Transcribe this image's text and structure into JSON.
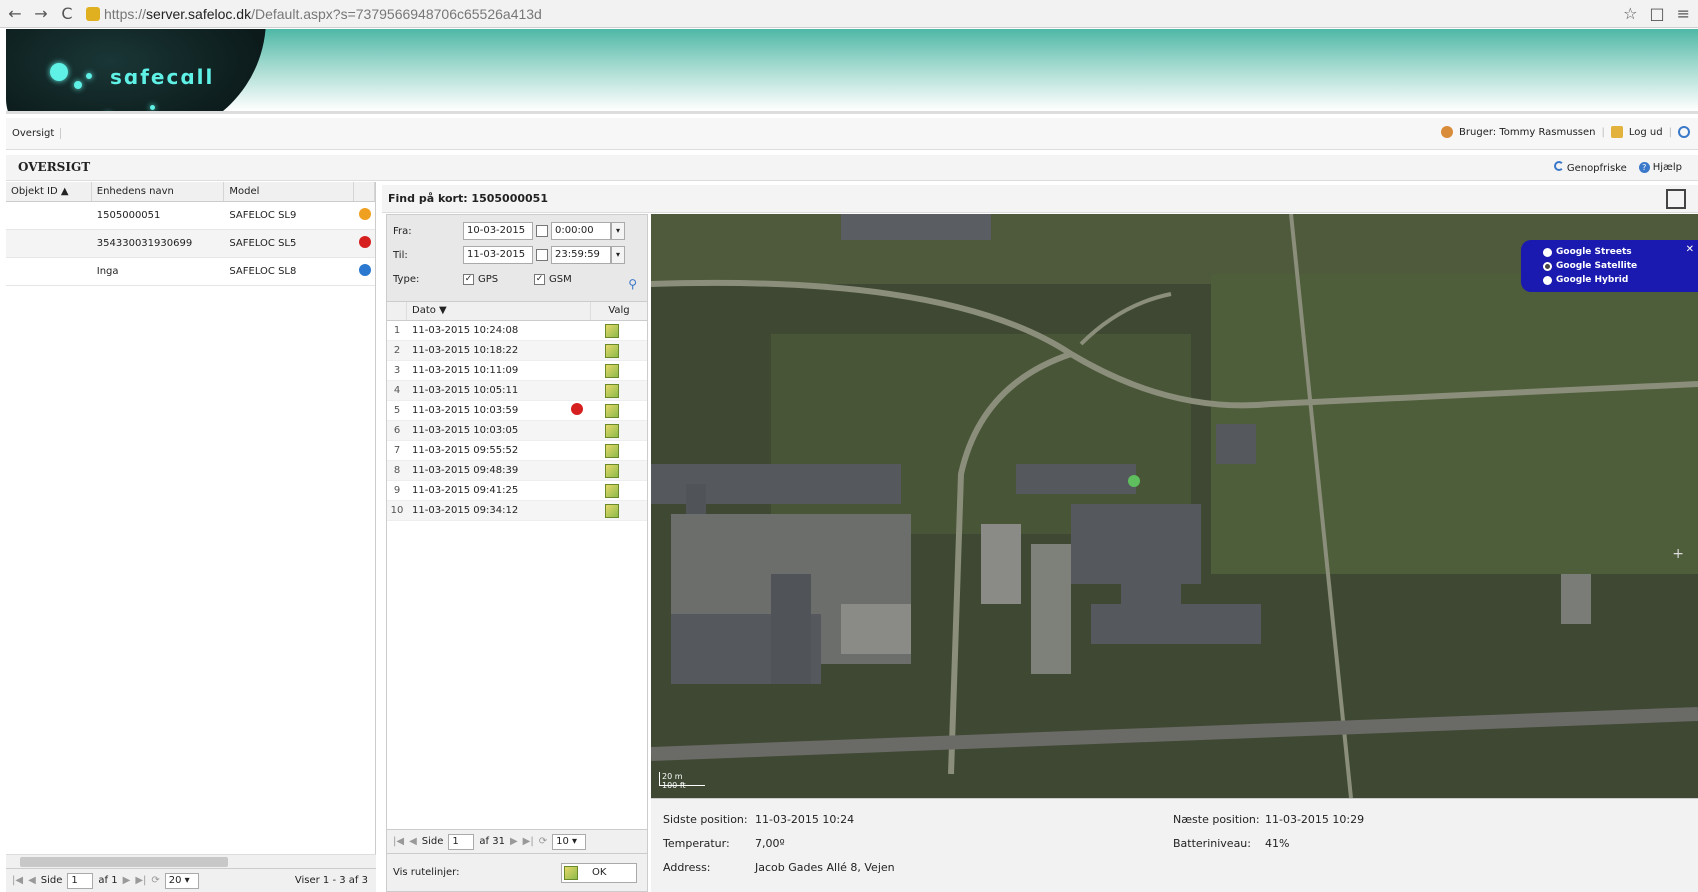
{
  "browser": {
    "back": "←",
    "forward": "→",
    "reload": "C",
    "url_scheme": "https://",
    "url_host": "server.safeloc.dk",
    "url_path": "/Default.aspx?s=7379566948706c65526a413d",
    "star": "☆",
    "window": "□",
    "menu": "≡"
  },
  "brand": {
    "logo_text": "sɑfecɑll"
  },
  "topnav": {
    "overview_link": "Oversigt",
    "user_label": "Bruger: Tommy Rasmussen",
    "logout_label": "Log ud"
  },
  "section": {
    "title": "OVERSIGT",
    "refresh_label": "Genopfriske",
    "help_label": "Hjælp"
  },
  "device_grid": {
    "columns": [
      "Objekt ID ▲",
      "Enhedens navn",
      "Model"
    ],
    "rows": [
      {
        "id": "",
        "name": "1505000051",
        "model": "SAFELOC SL9",
        "status_color": "#f0a020"
      },
      {
        "id": "",
        "name": "354330031930699",
        "model": "SAFELOC SL5",
        "status_color": "#d62020"
      },
      {
        "id": "",
        "name": "Inga",
        "model": "SAFELOC SL8",
        "status_color": "#2a78d0"
      }
    ],
    "pager": {
      "first": "|◀",
      "prev": "◀",
      "page_label": "Side",
      "page": "1",
      "of_label": "af 1",
      "next": "▶",
      "last": "▶|",
      "refresh": "⟳",
      "page_size": "20 ▾",
      "summary": "Viser 1 - 3 af 3"
    }
  },
  "find": {
    "title": "Find på kort: 1505000051",
    "from_label": "Fra:",
    "from_date": "10-03-2015",
    "from_time": "0:00:00",
    "to_label": "Til:",
    "to_date": "11-03-2015",
    "to_time": "23:59:59",
    "type_label": "Type:",
    "gps_label": "GPS",
    "gsm_label": "GSM",
    "check": "✓",
    "dropdown": "▾",
    "search_icon": "⚲",
    "columns": {
      "date": "Dato ▼",
      "choice": "Valg"
    },
    "positions": [
      {
        "n": "1",
        "date": "11-03-2015 10:24:08",
        "current": false
      },
      {
        "n": "2",
        "date": "11-03-2015 10:18:22",
        "current": false
      },
      {
        "n": "3",
        "date": "11-03-2015 10:11:09",
        "current": false
      },
      {
        "n": "4",
        "date": "11-03-2015 10:05:11",
        "current": false
      },
      {
        "n": "5",
        "date": "11-03-2015 10:03:59",
        "current": true
      },
      {
        "n": "6",
        "date": "11-03-2015 10:03:05",
        "current": false
      },
      {
        "n": "7",
        "date": "11-03-2015 09:55:52",
        "current": false
      },
      {
        "n": "8",
        "date": "11-03-2015 09:48:39",
        "current": false
      },
      {
        "n": "9",
        "date": "11-03-2015 09:41:25",
        "current": false
      },
      {
        "n": "10",
        "date": "11-03-2015 09:34:12",
        "current": false
      }
    ],
    "pager": {
      "first": "|◀",
      "prev": "◀",
      "page_label": "Side",
      "page": "1",
      "of_label": "af 31",
      "next": "▶",
      "last": "▶|",
      "refresh": "⟳",
      "page_size": "10 ▾"
    },
    "routes_label": "Vis rutelinjer:",
    "ok_label": "OK"
  },
  "map": {
    "layers": [
      "Google Streets",
      "Google Satellite",
      "Google Hybrid"
    ],
    "selected_layer": 1,
    "close": "✕",
    "scale_m": "20 m",
    "scale_ft": "100 ft",
    "zoom_in": "+"
  },
  "info": {
    "last_label": "Sidste position:",
    "last_value": "11-03-2015 10:24",
    "temp_label": "Temperatur:",
    "temp_value": "7,00º",
    "address_label": "Address:",
    "address_value": "Jacob Gades Allé 8, Vejen",
    "next_label": "Næste position:",
    "next_value": "11-03-2015 10:29",
    "battery_label": "Batteriniveau:",
    "battery_value": "41%"
  }
}
